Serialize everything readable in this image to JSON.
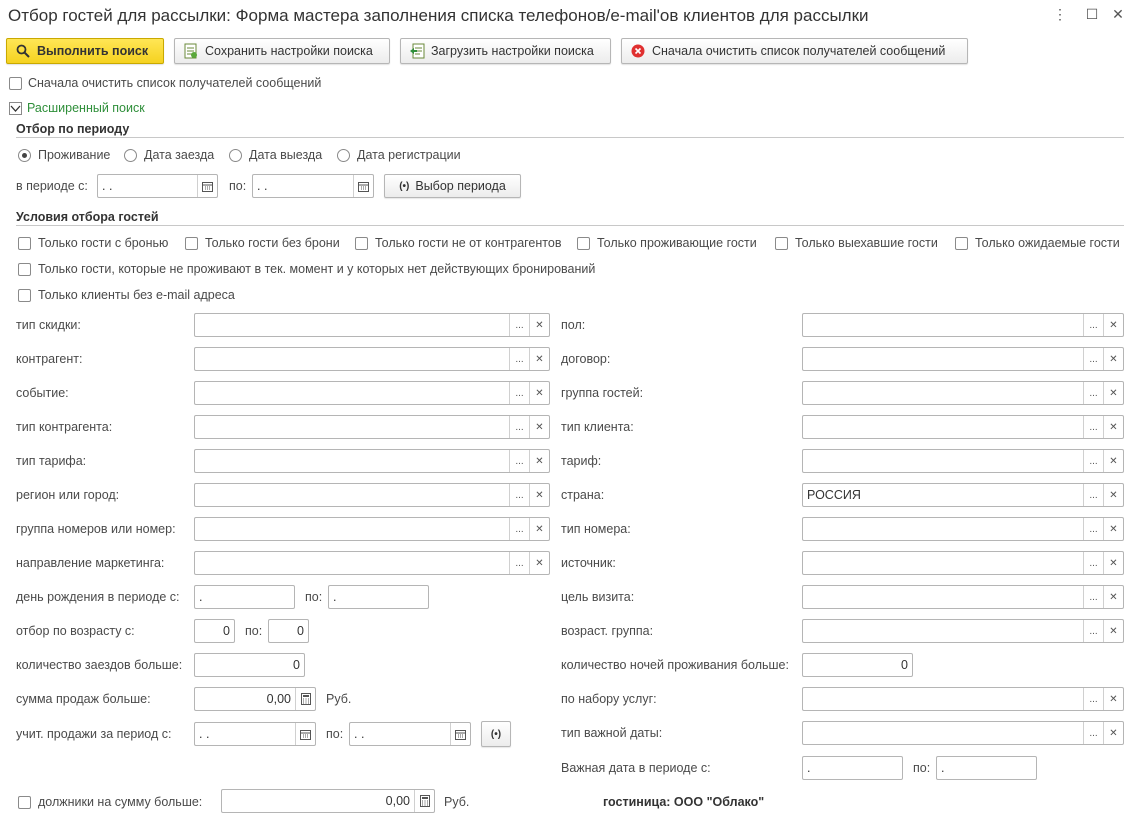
{
  "window": {
    "title": "Отбор гостей для рассылки: Форма мастера заполнения списка телефонов/e-mail'ов клиентов для рассылки",
    "menu_glyph": "⋮",
    "maximize_glyph": "☐",
    "close_glyph": "✕"
  },
  "toolbar": {
    "run_search": "Выполнить поиск",
    "save_settings": "Сохранить настройки поиска",
    "load_settings": "Загрузить настройки поиска",
    "clear_recipients": "Сначала очистить список получателей сообщений"
  },
  "options": {
    "clear_first": "Сначала очистить список получателей сообщений",
    "advanced_search": "Расширенный поиск"
  },
  "period": {
    "section_title": "Отбор по периоду",
    "radios": [
      "Проживание",
      "Дата заезда",
      "Дата выезда",
      "Дата регистрации"
    ],
    "selected_index": 0,
    "from_label": "в периоде с:",
    "from_value": " .   .",
    "to_label": "по:",
    "to_value": " .   .",
    "select_period": "Выбор периода"
  },
  "conditions": {
    "section_title": "Условия отбора гостей",
    "checks_row1": [
      "Только гости с бронью",
      "Только гости без брони",
      "Только гости не от контрагентов",
      "Только проживающие гости",
      "Только выехавшие гости",
      "Только ожидаемые гости"
    ],
    "check_row2": "Только гости, которые не проживают в тек. момент и у которых нет действующих бронирований",
    "check_row3": "Только клиенты без e-mail адреса"
  },
  "left_fields": {
    "discount_type": "тип скидки:",
    "contractor": "контрагент:",
    "event": "событие:",
    "contractor_type": "тип контрагента:",
    "tariff_type": "тип тарифа:",
    "region": "регион или город:",
    "room_group": "группа номеров или номер:",
    "marketing": "направление маркетинга:",
    "birthday_label": "день рождения в периоде с:",
    "birthday_from": " .",
    "birthday_to_label": "по:",
    "birthday_to": " .",
    "age_label": "отбор по возрасту с:",
    "age_from": "0",
    "age_to_label": "по:",
    "age_to": "0",
    "checkins_label": "количество заездов больше:",
    "checkins_value": "0",
    "sales_label": "сумма продаж больше:",
    "sales_value": "0,00",
    "sales_unit": "Руб.",
    "sales_period_label": "учит. продажи за период с:",
    "sales_period_from": " .   .",
    "sales_period_to_label": "по:",
    "sales_period_to": " .   ."
  },
  "right_fields": {
    "gender": "пол:",
    "contract": "договор:",
    "guest_group": "группа гостей:",
    "client_type": "тип клиента:",
    "tariff": "тариф:",
    "country": "страна:",
    "country_value": "РОССИЯ",
    "room_type": "тип номера:",
    "source": "источник:",
    "visit_purpose": "цель визита:",
    "age_group": "возраст. группа:",
    "nights_label": "количество ночей проживания больше:",
    "nights_value": "0",
    "services": "по набору услуг:",
    "important_date_type": "тип важной даты:",
    "important_date_label": "Важная дата в периоде с:",
    "important_date_from": " .",
    "important_date_to_label": "по:",
    "important_date_to": " ."
  },
  "footer": {
    "debtors_label": "должники на сумму больше:",
    "debtors_value": "0,00",
    "debtors_unit": "Руб.",
    "hotel": "гостиница: ООО \"Облако\""
  },
  "glyphs": {
    "select": "...",
    "clear": "✕",
    "calendar": "calendar-icon",
    "period": "(•)"
  },
  "colors": {
    "primary_button": "#f5d220",
    "accent_green": "#2f8f3a",
    "clear_red": "#e03030"
  }
}
